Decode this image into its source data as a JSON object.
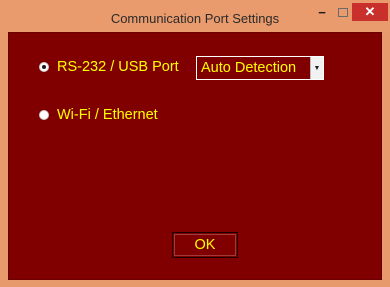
{
  "window": {
    "title": "Communication Port Settings",
    "minimize_glyph": "−",
    "close_glyph": "✕"
  },
  "options": {
    "rs232_label": "RS-232 / USB Port",
    "rs232_checked": true,
    "wifi_label": "Wi-Fi / Ethernet",
    "wifi_checked": false
  },
  "port_select": {
    "value": "Auto Detection",
    "arrow_glyph": "▼"
  },
  "ok_label": "OK",
  "colors": {
    "frame": "#e79a6c",
    "client_background": "#800000",
    "text": "#ffff00",
    "close_button": "#c9302c"
  }
}
